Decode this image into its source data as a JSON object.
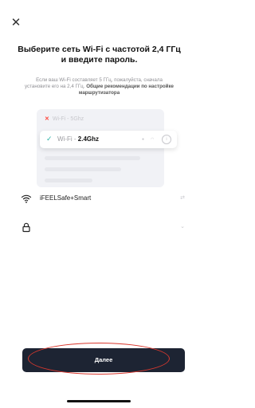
{
  "header": {
    "close_icon": "close-icon"
  },
  "title": "Выберите сеть Wi-Fi с частотой 2,4 ГГц и введите пароль.",
  "description": {
    "text": "Если ваш Wi-Fi составляет 5 ГГц, пожалуйста, сначала установите его на 2,4 ГГц.",
    "link": "Общие рекомендации по настройке маршрутизатора"
  },
  "illustration": {
    "option_5ghz": {
      "prefix": "Wi-Fi - ",
      "band": "5Ghz",
      "icon": "cross-icon"
    },
    "option_24ghz": {
      "prefix": "Wi-Fi - ",
      "band": "2.4Ghz",
      "icon": "check-icon"
    }
  },
  "network_field": {
    "value": "iFEELSafe+Smart",
    "icon": "wifi-icon",
    "trailing_icon": "swap-icon"
  },
  "password_field": {
    "value": "",
    "icon": "lock-icon",
    "trailing_icon": "chevron-down-icon"
  },
  "next_button": {
    "label": "Далее"
  },
  "colors": {
    "button_bg": "#1d2433",
    "annotation_ellipse": "#d9382e",
    "check": "#2ab3a6",
    "cross": "#ff453a"
  }
}
